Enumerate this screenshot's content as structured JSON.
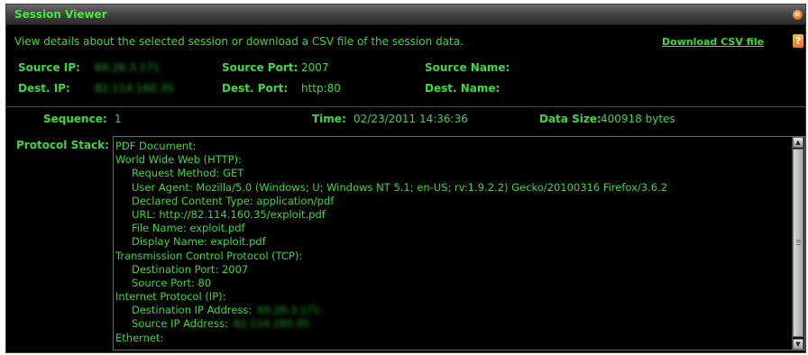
{
  "window": {
    "title": "Session Viewer",
    "close_icon": "close-icon",
    "help_icon": "help-icon",
    "help_glyph": "?"
  },
  "description": "View details about the selected session or download a CSV file of the session data.",
  "download_link": "Download CSV file",
  "source_ip": {
    "label": "Source IP:",
    "value": "69.26.3.171"
  },
  "source_port": {
    "label": "Source Port:",
    "value": "2007"
  },
  "source_name": {
    "label": "Source Name:",
    "value": ""
  },
  "dest_ip": {
    "label": "Dest. IP:",
    "value": "82.114.160.35"
  },
  "dest_port": {
    "label": "Dest. Port:",
    "value": "http:80"
  },
  "dest_name": {
    "label": "Dest. Name:",
    "value": ""
  },
  "sequence": {
    "label": "Sequence:",
    "value": "1"
  },
  "time": {
    "label": "Time:",
    "value": "02/23/2011 14:36:36"
  },
  "data_size": {
    "label": "Data Size:",
    "value": "400918 bytes"
  },
  "protocol_stack": {
    "label": "Protocol Stack:",
    "lines": [
      "PDF Document:",
      "World Wide Web (HTTP):",
      "Request Method: GET",
      "User Agent: Mozilla/5.0 (Windows; U; Windows NT 5.1; en-US; rv:1.9.2.2) Gecko/20100316 Firefox/3.6.2",
      "Declared Content Type: application/pdf",
      "URL: http://82.114.160.35/exploit.pdf",
      "File Name: exploit.pdf",
      "Display Name: exploit.pdf",
      "Transmission Control Protocol (TCP):",
      "Destination Port: 2007",
      "Source Port: 80",
      "Internet Protocol (IP):",
      "Destination IP Address:",
      "Source IP Address:",
      "Ethernet:"
    ],
    "blurred_values": {
      "destination_ip": "69.26.3.171",
      "source_ip": "82.114.160.35"
    }
  },
  "colors": {
    "text_green": "#3fd83f",
    "background": "#000000",
    "titlebar": "#474747",
    "accent_orange": "#e37420"
  }
}
